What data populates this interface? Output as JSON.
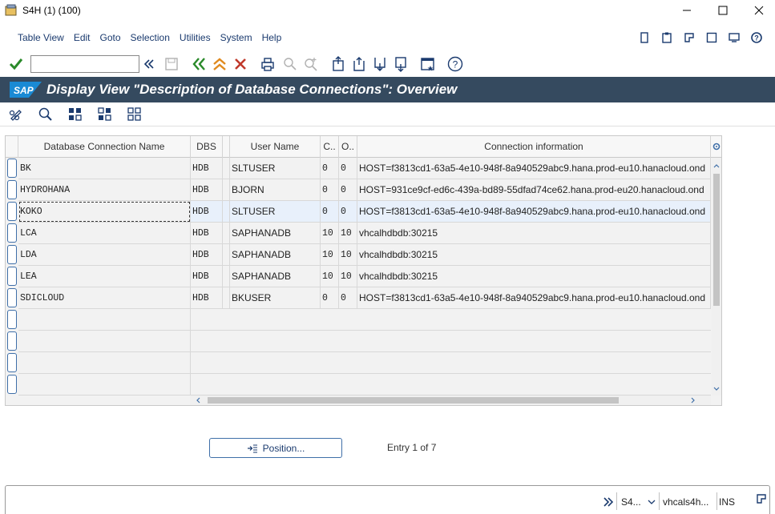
{
  "window": {
    "title": "S4H (1) (100)"
  },
  "menu": [
    "Table View",
    "Edit",
    "Goto",
    "Selection",
    "Utilities",
    "System",
    "Help"
  ],
  "command_field": {
    "value": ""
  },
  "header": {
    "title": "Display View \"Description of Database Connections\": Overview",
    "logo": "SAP"
  },
  "table": {
    "columns": [
      "Database Connection Name",
      "DBS",
      "",
      "User Name",
      "C..",
      "O..",
      "Connection information"
    ],
    "rows": [
      {
        "name": "BK",
        "dbs": "HDB",
        "user": "SLTUSER",
        "c": "0",
        "o": "0",
        "info": "HOST=f3813cd1-63a5-4e10-948f-8a940529abc9.hana.prod-eu10.hanacloud.ond"
      },
      {
        "name": "HYDROHANA",
        "dbs": "HDB",
        "user": "BJORN",
        "c": "0",
        "o": "0",
        "info": "HOST=931ce9cf-ed6c-439a-bd89-55dfad74ce62.hana.prod-eu20.hanacloud.ond"
      },
      {
        "name": "KOKO",
        "dbs": "HDB",
        "user": "SLTUSER",
        "c": "0",
        "o": "0",
        "info": "HOST=f3813cd1-63a5-4e10-948f-8a940529abc9.hana.prod-eu10.hanacloud.ond"
      },
      {
        "name": "LCA",
        "dbs": "HDB",
        "user": "SAPHANADB",
        "c": "10",
        "o": "10",
        "info": "vhcalhdbdb:30215"
      },
      {
        "name": "LDA",
        "dbs": "HDB",
        "user": "SAPHANADB",
        "c": "10",
        "o": "10",
        "info": "vhcalhdbdb:30215"
      },
      {
        "name": "LEA",
        "dbs": "HDB",
        "user": "SAPHANADB",
        "c": "10",
        "o": "10",
        "info": "vhcalhdbdb:30215"
      },
      {
        "name": "SDICLOUD",
        "dbs": "HDB",
        "user": "BKUSER",
        "c": "0",
        "o": "0",
        "info": "HOST=f3813cd1-63a5-4e10-948f-8a940529abc9.hana.prod-eu10.hanacloud.ond"
      }
    ]
  },
  "position_button": {
    "label": "Position..."
  },
  "entry_info": "Entry 1 of 7",
  "statusbar": {
    "system": "S4...",
    "server": "vhcals4h...",
    "mode": "INS"
  },
  "colors": {
    "header_bg": "#354a5f",
    "accent": "#3f6fa8",
    "ok_green": "#2a8a2a",
    "cancel_red": "#c0392b",
    "nav_orange": "#e08a1e"
  }
}
